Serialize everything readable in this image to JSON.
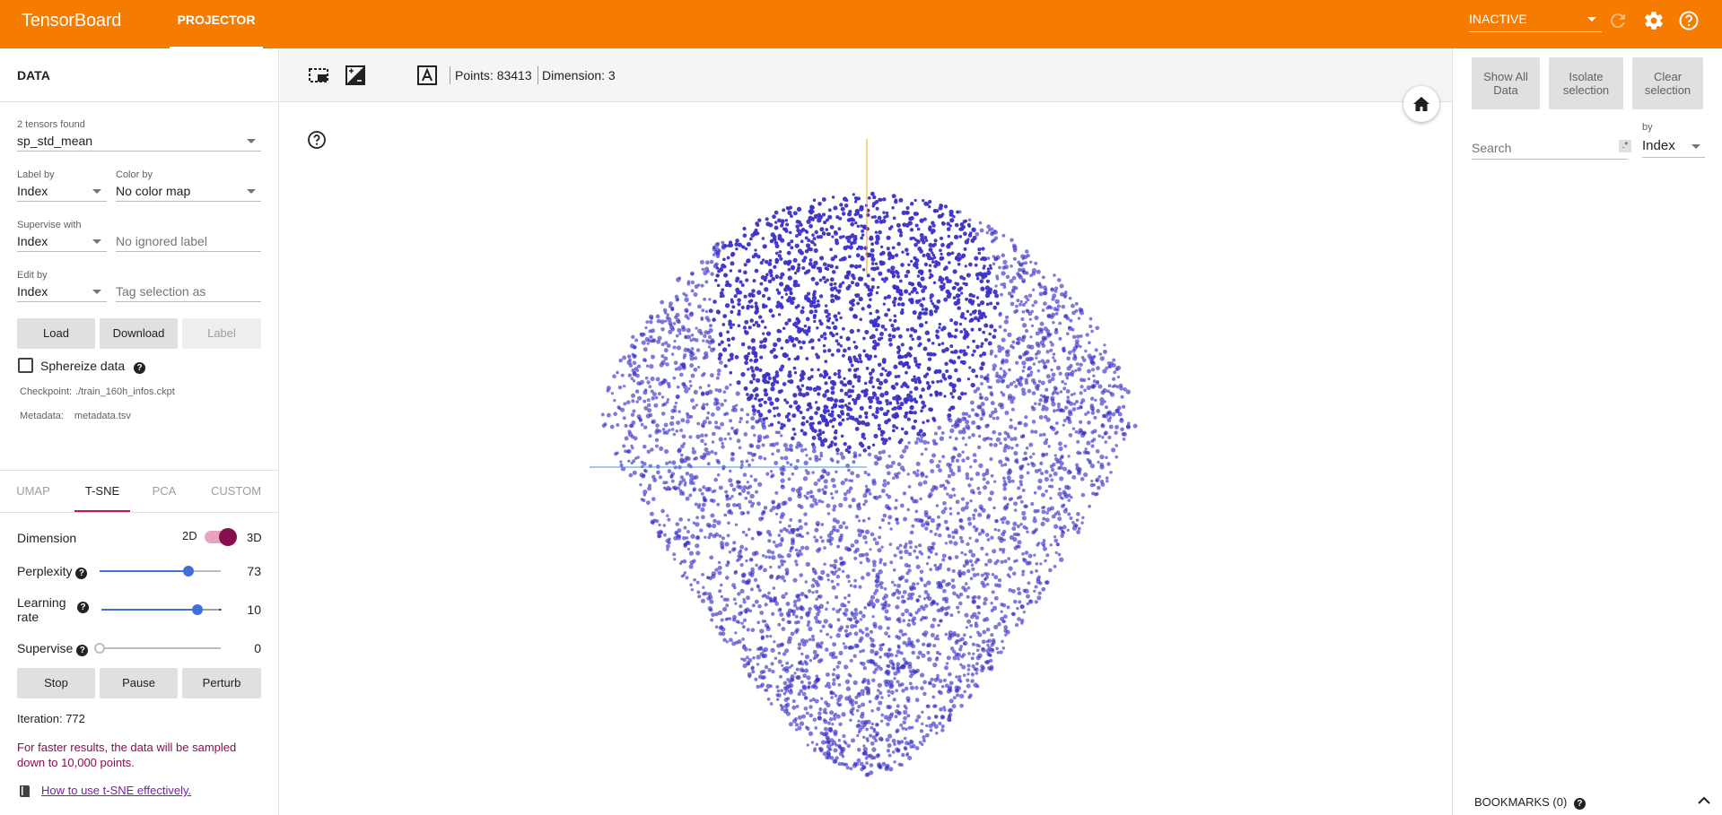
{
  "header": {
    "brand": "TensorBoard",
    "tab": "PROJECTOR",
    "run_status": "INACTIVE"
  },
  "data_panel": {
    "title": "DATA",
    "tensors_found": "2 tensors found",
    "tensor": "sp_std_mean",
    "label_by": {
      "label": "Label by",
      "value": "Index"
    },
    "color_by": {
      "label": "Color by",
      "value": "No color map"
    },
    "supervise_with": {
      "label": "Supervise with",
      "value": "Index"
    },
    "ignored_label": {
      "placeholder": "No ignored label"
    },
    "edit_by": {
      "label": "Edit by",
      "value": "Index"
    },
    "tag_selection": {
      "placeholder": "Tag selection as"
    },
    "buttons": {
      "load": "Load",
      "download": "Download",
      "label": "Label"
    },
    "sphereize": {
      "label": "Sphereize data",
      "checked": false
    },
    "checkpoint": {
      "label": "Checkpoint:",
      "value": "./train_160h_infos.ckpt"
    },
    "metadata": {
      "label": "Metadata:",
      "value": "metadata.tsv"
    }
  },
  "projection_tabs": [
    {
      "label": "UMAP",
      "active": false
    },
    {
      "label": "T-SNE",
      "active": true
    },
    {
      "label": "PCA",
      "active": false
    },
    {
      "label": "CUSTOM",
      "active": false
    }
  ],
  "tsne": {
    "dimension": {
      "label": "Dimension",
      "left": "2D",
      "right": "3D",
      "value": "3D"
    },
    "perplexity": {
      "label": "Perplexity",
      "value": "73",
      "fraction": 0.73
    },
    "learning_rate": {
      "label": "Learning rate",
      "value": "10",
      "fraction": 0.8
    },
    "supervise": {
      "label": "Supervise",
      "value": "0",
      "fraction": 0
    },
    "buttons": {
      "stop": "Stop",
      "pause": "Pause",
      "perturb": "Perturb"
    },
    "iteration": "Iteration: 772",
    "note": "For faster results, the data will be sampled down to 10,000 points.",
    "link": "How to use t-SNE effectively."
  },
  "toolbar": {
    "points": "Points: 83413",
    "dimension": "Dimension: 3"
  },
  "inspector": {
    "show_all": "Show All Data",
    "isolate": "Isolate selection",
    "clear": "Clear selection",
    "search_placeholder": "Search",
    "regex": ".*",
    "by_label": "by",
    "by_value": "Index",
    "bookmarks": "BOOKMARKS (0)"
  },
  "colors": {
    "accent": "#f57c00",
    "points": "#3b32c8",
    "active_tab": "#c2185b",
    "note": "#880e4f"
  },
  "icons": [
    "refresh-icon",
    "gear-icon",
    "help-icon",
    "select-box-icon",
    "night-mode-icon",
    "label-toggle-icon",
    "home-icon",
    "book-icon",
    "chevron-up-icon"
  ]
}
